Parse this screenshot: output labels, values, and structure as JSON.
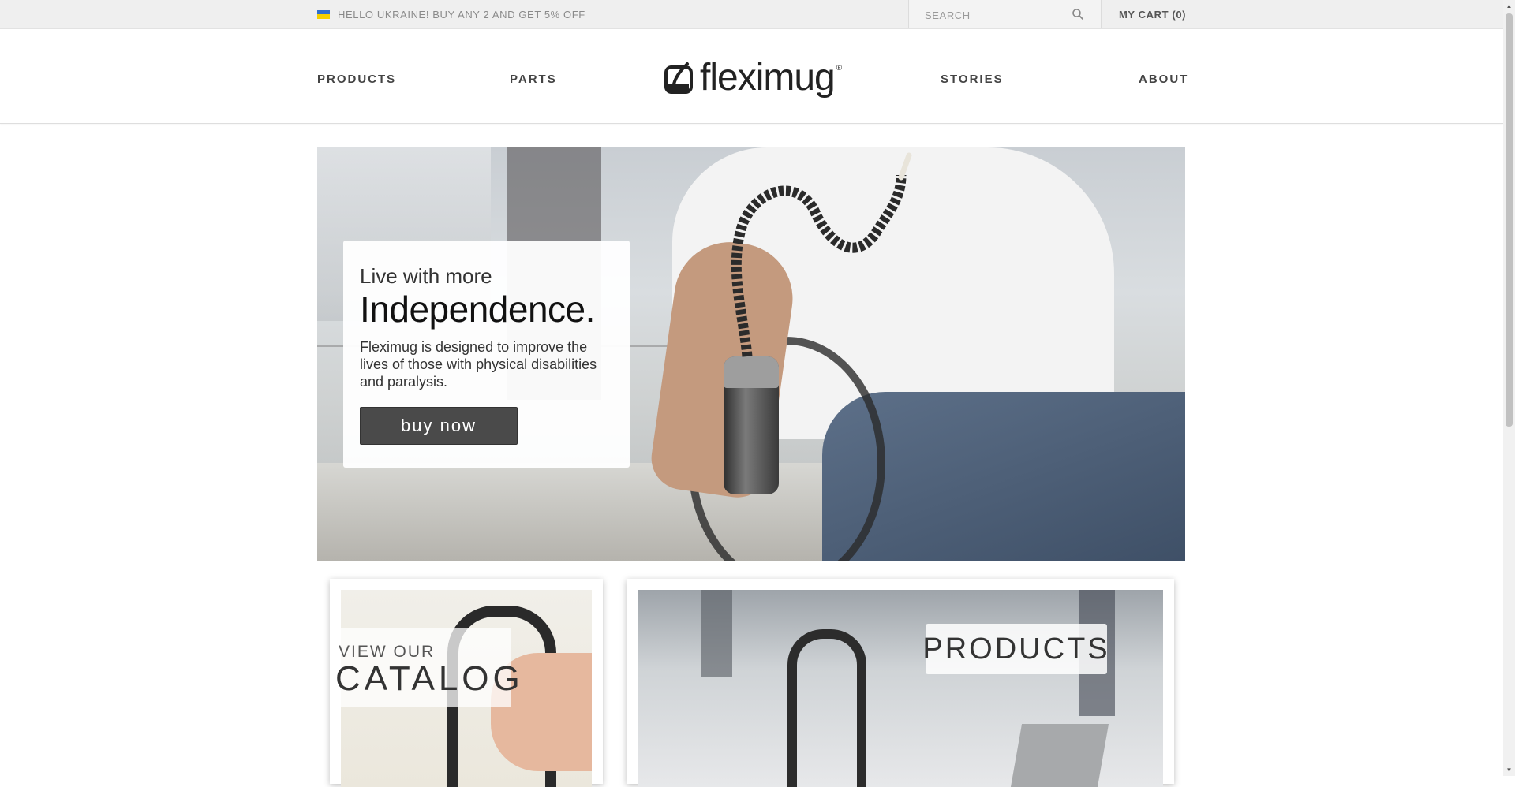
{
  "topbar": {
    "promo": "HELLO UKRAINE! BUY ANY 2 AND GET 5% OFF",
    "search_placeholder": "SEARCH",
    "cart": "MY CART (0)"
  },
  "nav": {
    "products": "PRODUCTS",
    "parts": "PARTS",
    "stories": "STORIES",
    "about": "ABOUT"
  },
  "logo": {
    "text": "fleximug",
    "reg": "®"
  },
  "hero": {
    "kicker": "Live with more",
    "title": "Independence.",
    "description": "Fleximug is designed to improve the lives of those with physical disabilities and paralysis.",
    "button": "buy now"
  },
  "cards": {
    "catalog_small": "VIEW OUR",
    "catalog_big": "CATALOG",
    "products": "PRODUCTS"
  },
  "icons": [
    "ukraine-flag-icon",
    "search-icon",
    "fleximug-logo-icon",
    "scroll-up-arrow-icon",
    "scroll-down-arrow-icon"
  ],
  "colors": {
    "button_bg": "#4a4a4a",
    "topbar_bg": "#efefef"
  }
}
